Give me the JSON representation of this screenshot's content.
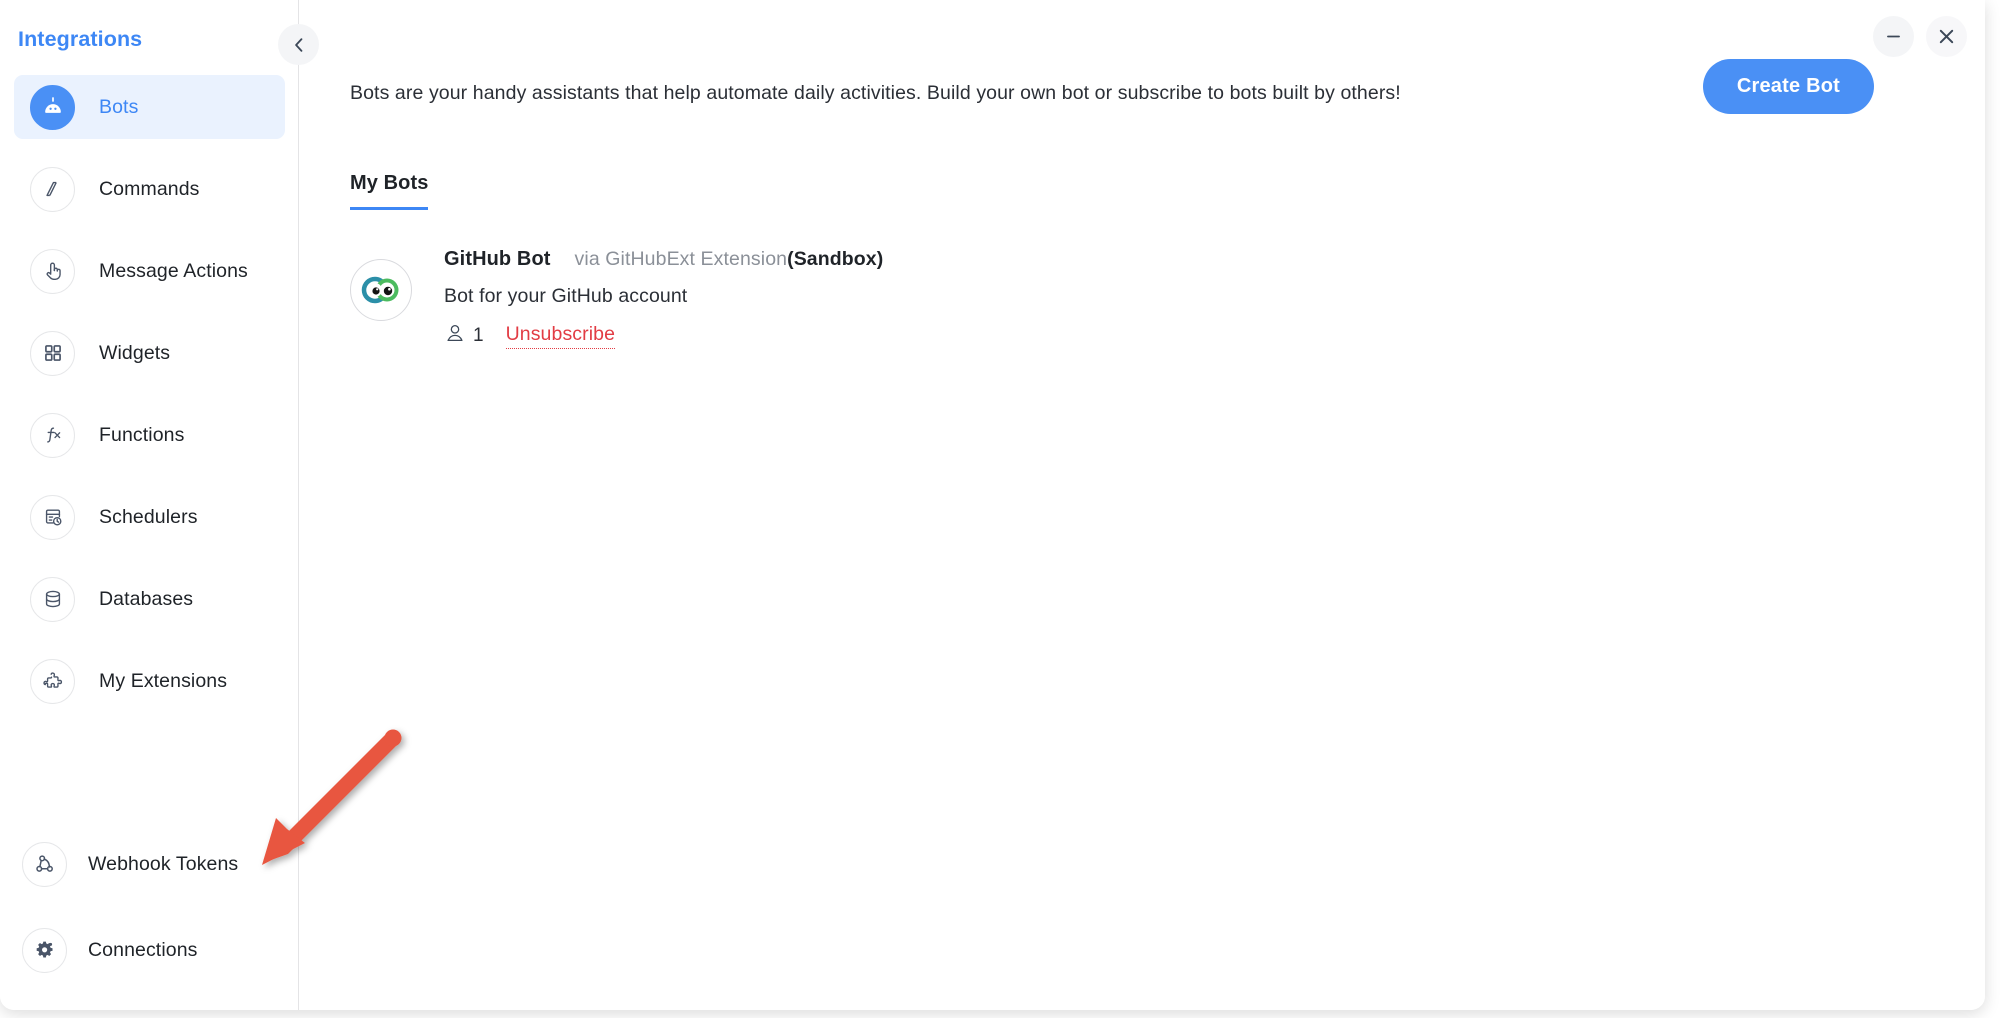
{
  "window": {
    "minimize_label": "minimize",
    "close_label": "close"
  },
  "sidebar": {
    "title": "Integrations",
    "collapse_label": "collapse-sidebar",
    "items": [
      {
        "label": "Bots",
        "icon": "bot-icon",
        "active": true
      },
      {
        "label": "Commands",
        "icon": "slash-command-icon",
        "active": false
      },
      {
        "label": "Message Actions",
        "icon": "tap-hand-icon",
        "active": false
      },
      {
        "label": "Widgets",
        "icon": "grid-squares-icon",
        "active": false
      },
      {
        "label": "Functions",
        "icon": "function-icon",
        "active": false
      },
      {
        "label": "Schedulers",
        "icon": "scheduler-clock-icon",
        "active": false
      },
      {
        "label": "Databases",
        "icon": "database-icon",
        "active": false
      },
      {
        "label": "My Extensions",
        "icon": "puzzle-piece-icon",
        "active": false
      }
    ],
    "bottom_items": [
      {
        "label": "Webhook Tokens",
        "icon": "webhook-icon"
      },
      {
        "label": "Connections",
        "icon": "gear-icon"
      }
    ]
  },
  "main": {
    "intro": "Bots are your handy assistants that help automate daily activities. Build your own bot or subscribe to bots built by others!",
    "create_button": "Create Bot",
    "tabs": [
      {
        "label": "My Bots",
        "active": true
      }
    ],
    "bots": [
      {
        "name": "GitHub Bot",
        "via": "via GitHubExt Extension",
        "scope": "(Sandbox)",
        "description": "Bot for your GitHub account",
        "subscriber_count": "1",
        "action_label": "Unsubscribe"
      }
    ]
  },
  "colors": {
    "accent_blue": "#4a90f5",
    "title_blue": "#3d87f5",
    "active_item_bg": "#eaf2fe",
    "danger_red": "#e23c44",
    "annotation_arrow": "#e8563f",
    "avatar_left_eye": "#2b8fa8",
    "avatar_right_eye": "#4cbb5f"
  }
}
